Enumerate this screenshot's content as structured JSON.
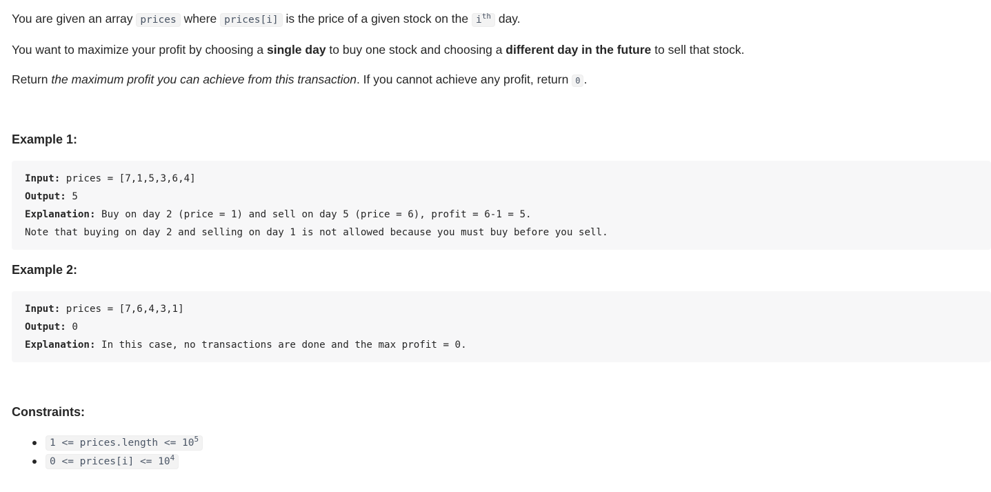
{
  "description": {
    "p1": {
      "t1": "You are given an array ",
      "c1": "prices",
      "t2": " where ",
      "c2": "prices[i]",
      "t3": " is the price of a given stock on the ",
      "c3_base": "i",
      "c3_sup": "th",
      "t4": " day."
    },
    "p2": {
      "t1": "You want to maximize your profit by choosing a ",
      "b1": "single day",
      "t2": " to buy one stock and choosing a ",
      "b2": "different day in the future",
      "t3": " to sell that stock."
    },
    "p3": {
      "t1": "Return ",
      "i1": "the maximum profit you can achieve from this transaction",
      "t2": ". If you cannot achieve any profit, return ",
      "c1": "0",
      "t3": "."
    }
  },
  "examples": [
    {
      "heading": "Example 1:",
      "input_label": "Input:",
      "input_value": " prices = [7,1,5,3,6,4]",
      "output_label": "Output:",
      "output_value": " 5",
      "explanation_label": "Explanation:",
      "explanation_value": " Buy on day 2 (price = 1) and sell on day 5 (price = 6), profit = 6-1 = 5.",
      "note": "Note that buying on day 2 and selling on day 1 is not allowed because you must buy before you sell."
    },
    {
      "heading": "Example 2:",
      "input_label": "Input:",
      "input_value": " prices = [7,6,4,3,1]",
      "output_label": "Output:",
      "output_value": " 0",
      "explanation_label": "Explanation:",
      "explanation_value": " In this case, no transactions are done and the max profit = 0."
    }
  ],
  "constraints": {
    "heading": "Constraints:",
    "items": [
      {
        "base": "1 <= prices.length <= 10",
        "sup": "5"
      },
      {
        "base": "0 <= prices[i] <= 10",
        "sup": "4"
      }
    ]
  }
}
